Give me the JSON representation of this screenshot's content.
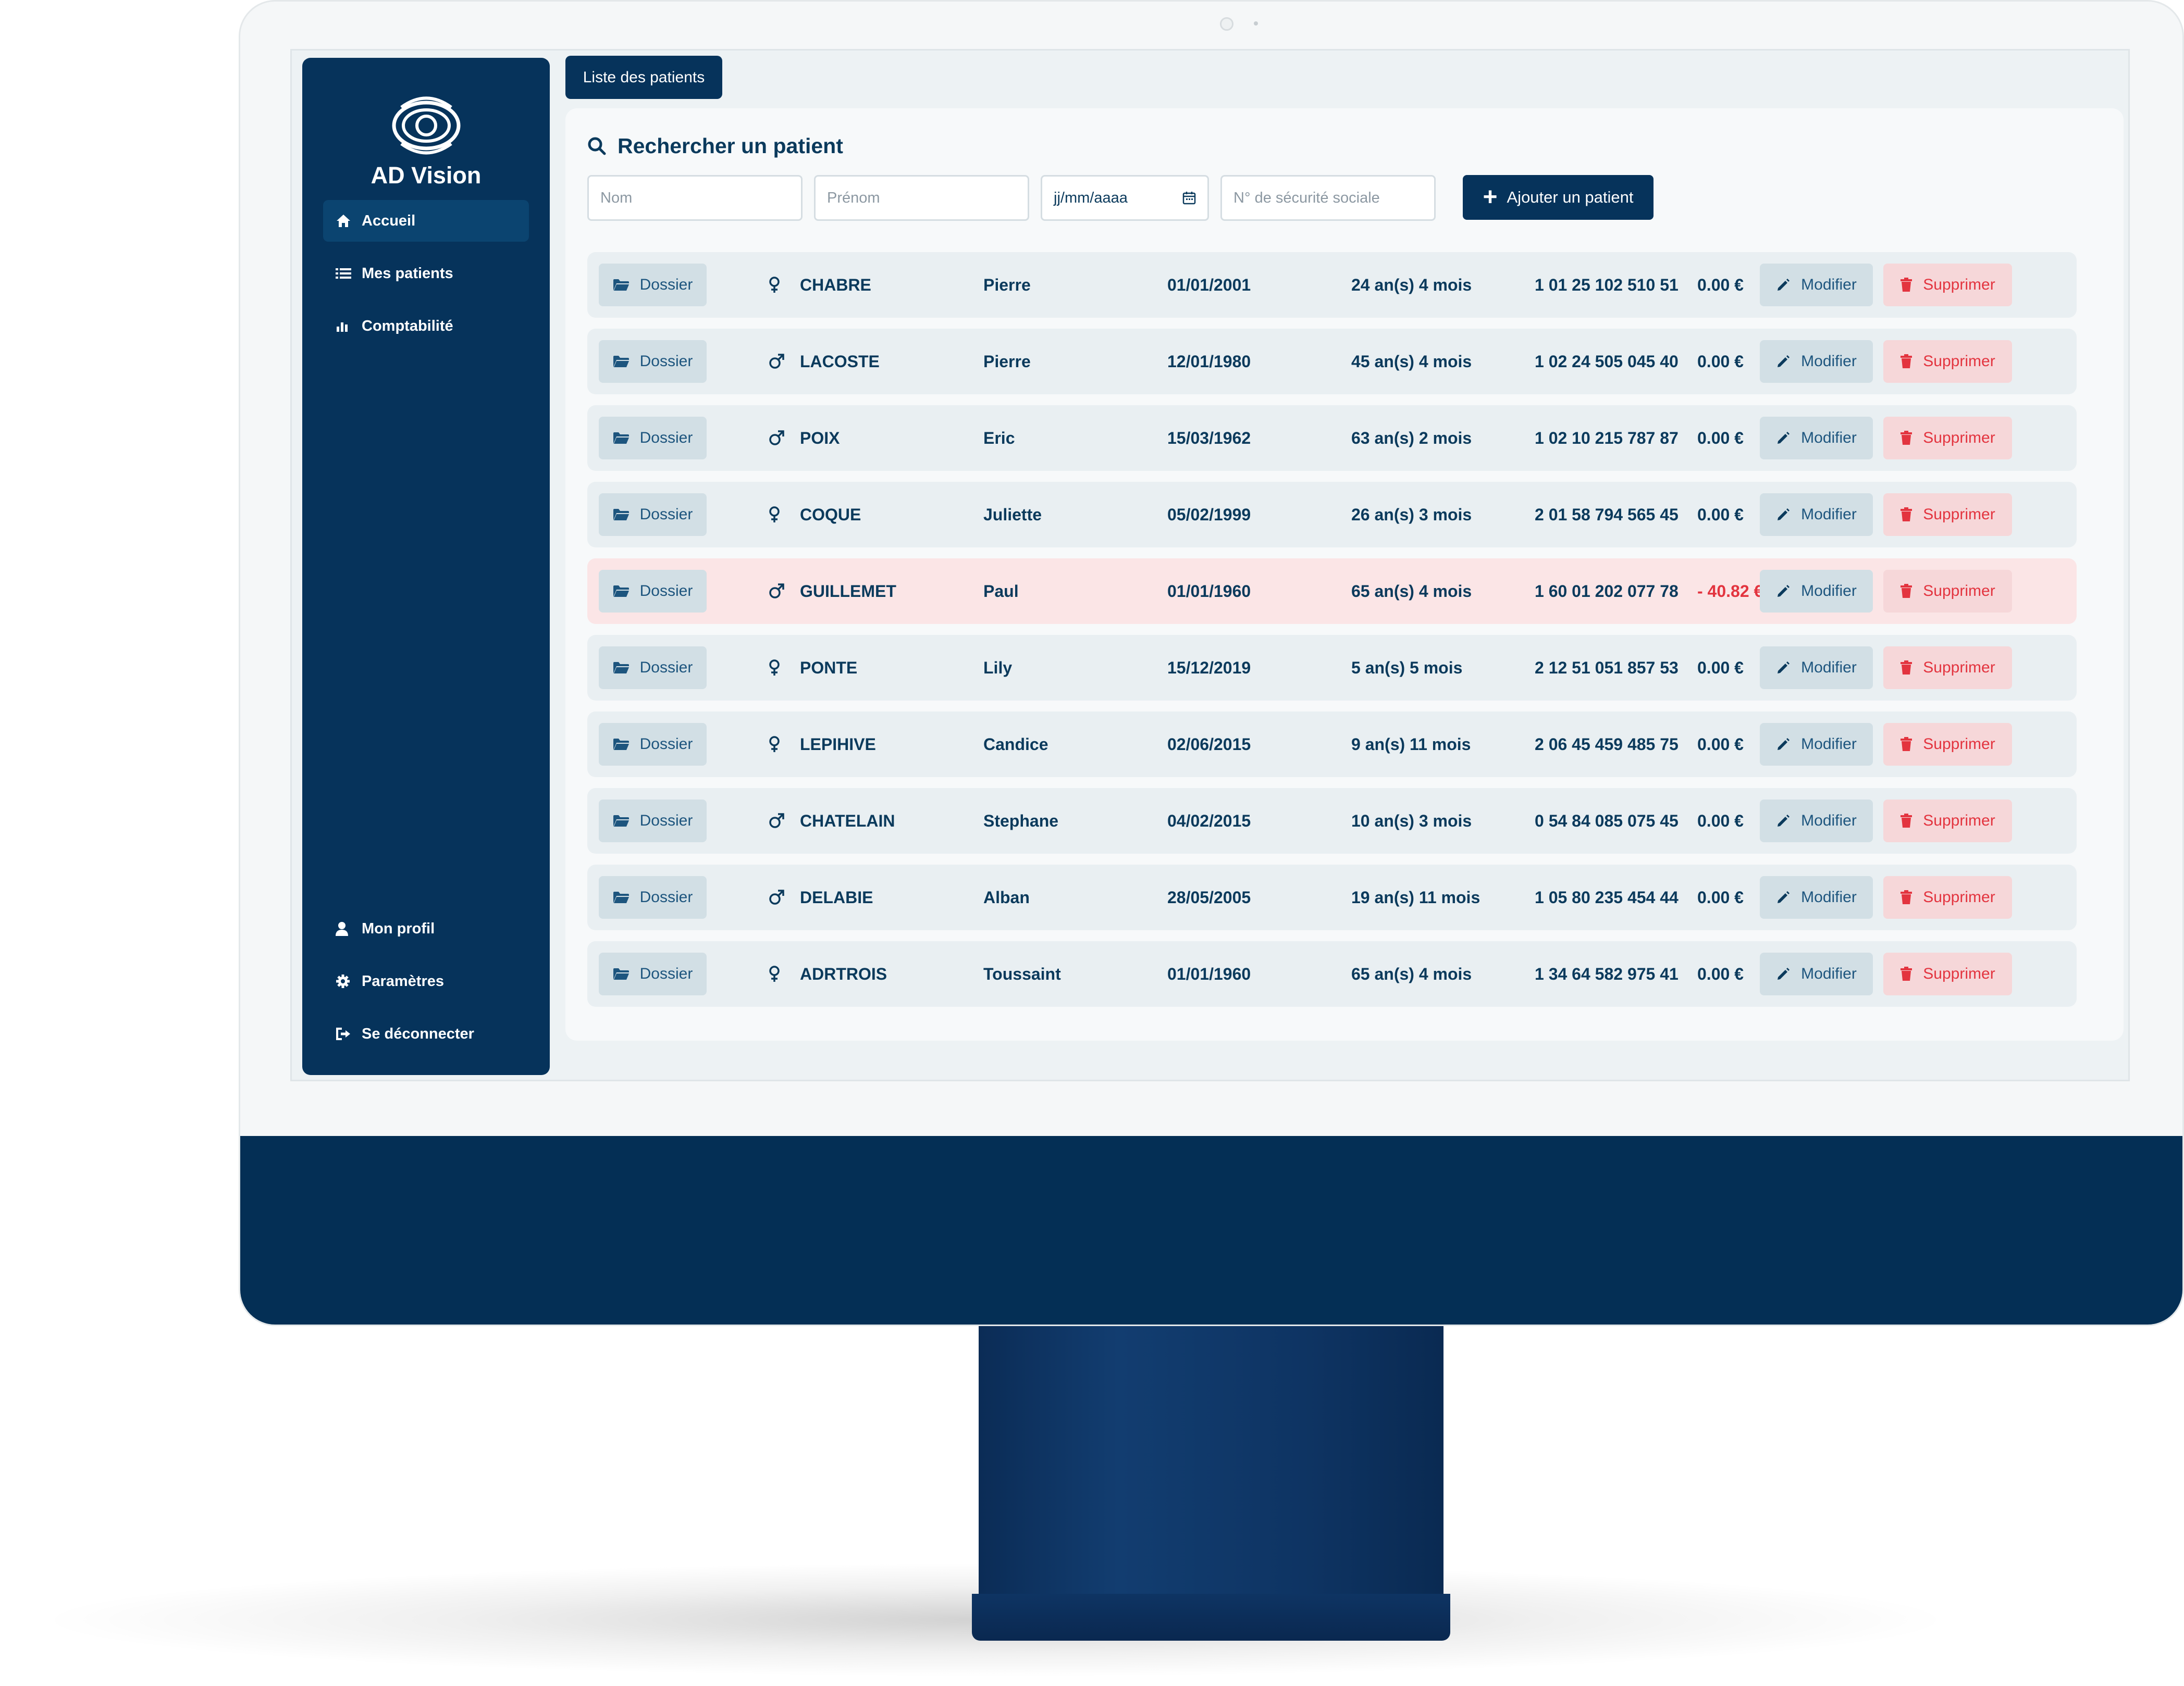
{
  "app": {
    "brand": "AD Vision",
    "tab": "Liste des patients"
  },
  "sidebar": {
    "nav": [
      {
        "label": "Accueil",
        "icon": "home-icon",
        "active": true
      },
      {
        "label": "Mes patients",
        "icon": "list-icon",
        "active": false
      },
      {
        "label": "Comptabilité",
        "icon": "chart-icon",
        "active": false
      }
    ],
    "bottom": [
      {
        "label": "Mon profil",
        "icon": "user-icon"
      },
      {
        "label": "Paramètres",
        "icon": "gear-icon"
      },
      {
        "label": "Se déconnecter",
        "icon": "logout-icon"
      }
    ]
  },
  "search": {
    "title": "Rechercher un patient",
    "nom_placeholder": "Nom",
    "prenom_placeholder": "Prénom",
    "date_placeholder": "jj/mm/aaaa",
    "secu_placeholder": "N° de sécurité sociale",
    "add_label": "Ajouter un patient"
  },
  "row_actions": {
    "dossier": "Dossier",
    "modifier": "Modifier",
    "supprimer": "Supprimer"
  },
  "patients": [
    {
      "nom": "CHABRE",
      "prenom": "Pierre",
      "naissance": "01/01/2001",
      "age": "24 an(s) 4 mois",
      "secu": "1 01 25 102 510 51",
      "solde": "0.00 €",
      "sexe": "female",
      "negative": false
    },
    {
      "nom": "LACOSTE",
      "prenom": "Pierre",
      "naissance": "12/01/1980",
      "age": "45 an(s) 4 mois",
      "secu": "1 02 24 505 045 40",
      "solde": "0.00 €",
      "sexe": "male",
      "negative": false
    },
    {
      "nom": "POIX",
      "prenom": "Eric",
      "naissance": "15/03/1962",
      "age": "63 an(s) 2 mois",
      "secu": "1 02 10 215 787 87",
      "solde": "0.00 €",
      "sexe": "male",
      "negative": false
    },
    {
      "nom": "COQUE",
      "prenom": "Juliette",
      "naissance": "05/02/1999",
      "age": "26 an(s) 3 mois",
      "secu": "2 01 58 794 565 45",
      "solde": "0.00 €",
      "sexe": "female",
      "negative": false
    },
    {
      "nom": "GUILLEMET",
      "prenom": "Paul",
      "naissance": "01/01/1960",
      "age": "65 an(s) 4 mois",
      "secu": "1 60 01 202 077 78",
      "solde": "- 40.82 €",
      "sexe": "male",
      "negative": true
    },
    {
      "nom": "PONTE",
      "prenom": "Lily",
      "naissance": "15/12/2019",
      "age": "5 an(s) 5 mois",
      "secu": "2 12 51 051 857 53",
      "solde": "0.00 €",
      "sexe": "female",
      "negative": false
    },
    {
      "nom": "LEPIHIVE",
      "prenom": "Candice",
      "naissance": "02/06/2015",
      "age": "9 an(s) 11 mois",
      "secu": "2 06 45 459 485 75",
      "solde": "0.00 €",
      "sexe": "female",
      "negative": false
    },
    {
      "nom": "CHATELAIN",
      "prenom": "Stephane",
      "naissance": "04/02/2015",
      "age": "10 an(s) 3 mois",
      "secu": "0 54 84 085 075 45",
      "solde": "0.00 €",
      "sexe": "male",
      "negative": false
    },
    {
      "nom": "DELABIE",
      "prenom": "Alban",
      "naissance": "28/05/2005",
      "age": "19 an(s) 11 mois",
      "secu": "1 05 80 235 454 44",
      "solde": "0.00 €",
      "sexe": "male",
      "negative": false
    },
    {
      "nom": "ADRTROIS",
      "prenom": "Toussaint",
      "naissance": "01/01/1960",
      "age": "65 an(s) 4 mois",
      "secu": "1 34 64 582 975 41",
      "solde": "0.00 €",
      "sexe": "female",
      "negative": false
    }
  ],
  "colors": {
    "primary": "#06335b",
    "danger": "#e3343f",
    "row_bg": "#e9eff2",
    "row_alert_bg": "#fbe5e6"
  }
}
